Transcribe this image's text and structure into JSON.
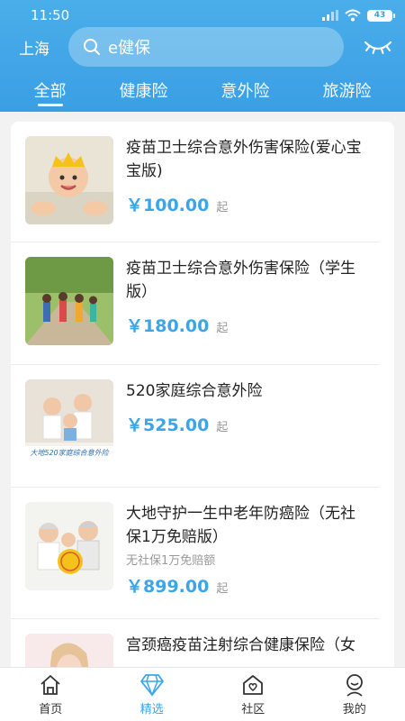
{
  "status": {
    "time": "11:50",
    "battery": "43"
  },
  "header": {
    "city": "上海",
    "search_text": "e健保",
    "tabs": [
      {
        "label": "全部"
      },
      {
        "label": "健康险"
      },
      {
        "label": "意外险"
      },
      {
        "label": "旅游险"
      }
    ]
  },
  "products": [
    {
      "title": "疫苗卫士综合意外伤害保险(爱心宝宝版)",
      "subtitle": "",
      "price": "￥100.00",
      "price_suffix": "起",
      "image": "baby-photo"
    },
    {
      "title": "疫苗卫士综合意外伤害保险（学生版）",
      "subtitle": "",
      "price": "￥180.00",
      "price_suffix": "起",
      "image": "students-photo"
    },
    {
      "title": "520家庭综合意外险",
      "subtitle": "",
      "price": "￥525.00",
      "price_suffix": "起",
      "image": "family-photo",
      "image_caption": "大地520家庭综合意外险"
    },
    {
      "title": "大地守护一生中老年防癌险（无社保1万免赔版）",
      "subtitle": "无社保1万免赔额",
      "price": "￥899.00",
      "price_suffix": "起",
      "image": "elderly-family-photo"
    },
    {
      "title": "宫颈癌疫苗注射综合健康保险（女",
      "subtitle": "",
      "price": "",
      "price_suffix": "",
      "image": "woman-photo"
    }
  ],
  "bottom_nav": [
    {
      "label": "首页",
      "icon": "home-icon"
    },
    {
      "label": "精选",
      "icon": "diamond-icon"
    },
    {
      "label": "社区",
      "icon": "community-icon"
    },
    {
      "label": "我的",
      "icon": "profile-icon"
    }
  ],
  "colors": {
    "accent": "#39a6ea",
    "header": "#4aaeea"
  }
}
